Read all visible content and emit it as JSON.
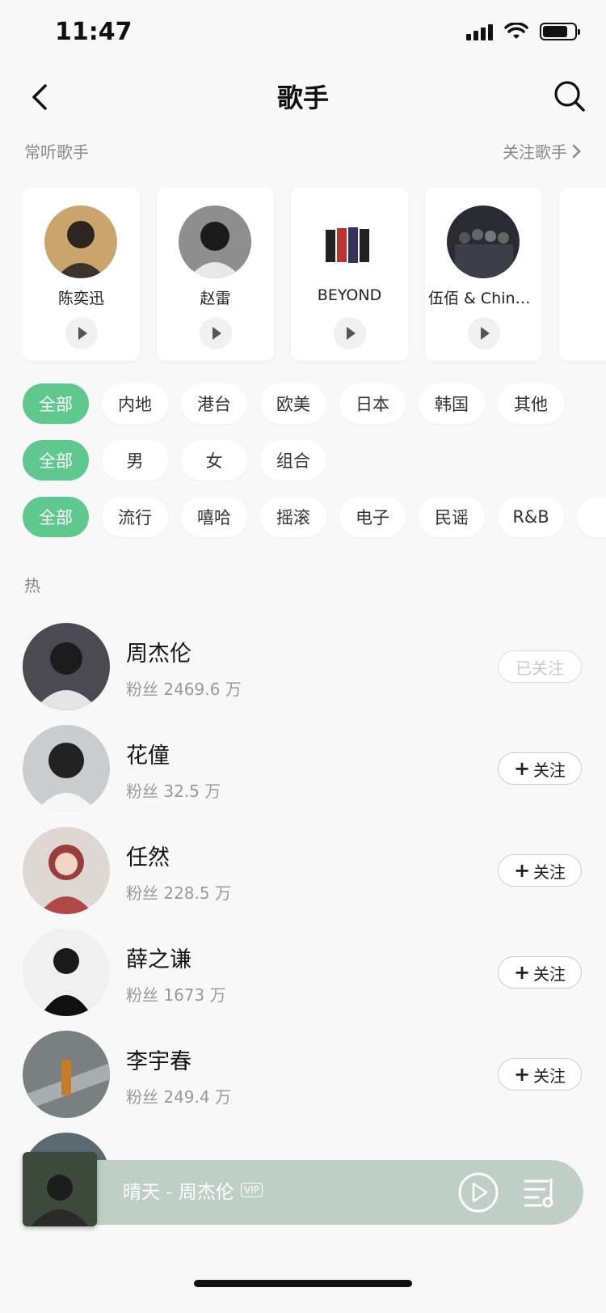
{
  "status": {
    "time": "11:47"
  },
  "nav": {
    "title": "歌手"
  },
  "frequent": {
    "label": "常听歌手",
    "follow_link": "关注歌手",
    "singers": [
      {
        "name": "陈奕迅"
      },
      {
        "name": "赵雷"
      },
      {
        "name": "BEYOND"
      },
      {
        "name": "伍佰 & China..."
      }
    ]
  },
  "filters": {
    "region": [
      "全部",
      "内地",
      "港台",
      "欧美",
      "日本",
      "韩国",
      "其他"
    ],
    "gender": [
      "全部",
      "男",
      "女",
      "组合"
    ],
    "genre": [
      "全部",
      "流行",
      "嘻哈",
      "摇滚",
      "电子",
      "民谣",
      "R&B"
    ]
  },
  "hot_label": "热",
  "singers": [
    {
      "name": "周杰伦",
      "fans": "粉丝 2469.6 万",
      "follow": "已关注",
      "followed": true
    },
    {
      "name": "花僮",
      "fans": "粉丝 32.5 万",
      "follow": "关注",
      "followed": false
    },
    {
      "name": "任然",
      "fans": "粉丝 228.5 万",
      "follow": "关注",
      "followed": false
    },
    {
      "name": "薛之谦",
      "fans": "粉丝 1673 万",
      "follow": "关注",
      "followed": false
    },
    {
      "name": "李宇春",
      "fans": "粉丝 249.4 万",
      "follow": "关注",
      "followed": false
    }
  ],
  "player": {
    "title": "晴天 - 周杰伦",
    "badge": "VIP"
  },
  "colors": {
    "accent": "#5fc98d",
    "player_bg": "#bfcfc6"
  }
}
